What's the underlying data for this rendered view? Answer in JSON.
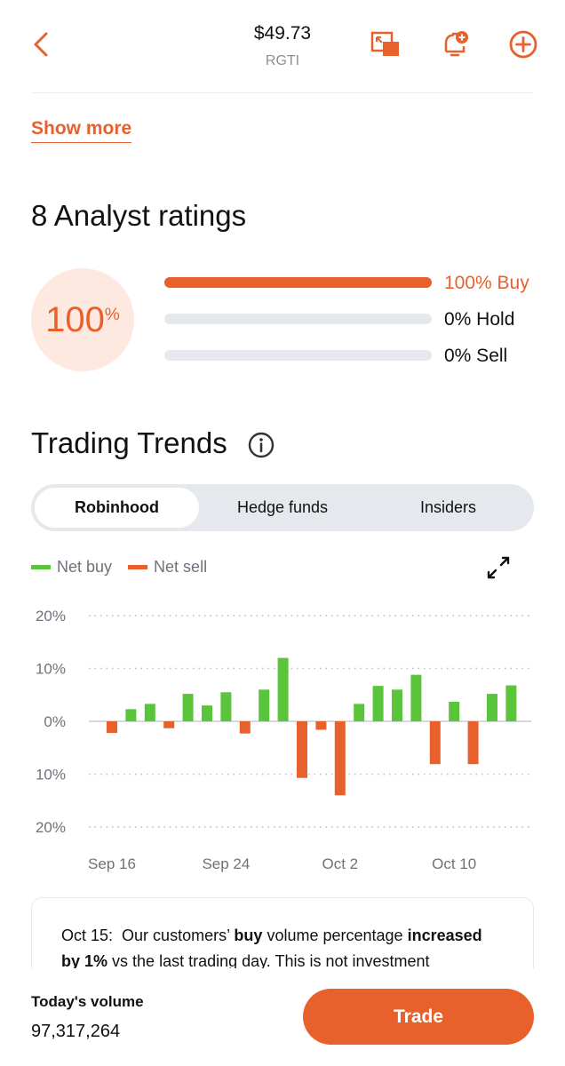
{
  "header": {
    "price": "$49.73",
    "ticker": "RGTI",
    "icons": [
      "back-arrow-icon",
      "picture-in-picture-icon",
      "bell-add-icon",
      "plus-circle-icon"
    ]
  },
  "about": {
    "show_more_label": "Show more"
  },
  "analyst": {
    "title": "8 Analyst ratings",
    "headline_value": "100",
    "headline_unit": "%",
    "ratings": [
      {
        "label": "100% Buy",
        "fraction": 1.0
      },
      {
        "label": "0% Hold",
        "fraction": 0.0
      },
      {
        "label": "0% Sell",
        "fraction": 0.0
      }
    ]
  },
  "trends": {
    "title": "Trading Trends",
    "tabs": [
      {
        "label": "Robinhood",
        "active": true
      },
      {
        "label": "Hedge funds",
        "active": false
      },
      {
        "label": "Insiders",
        "active": false
      }
    ],
    "legend": {
      "buy_label": "Net buy",
      "sell_label": "Net sell"
    },
    "summary": {
      "date": "Oct 15:",
      "text_1": "Our customers’",
      "bold_1": "buy",
      "text_2": "volume percentage",
      "bold_2": "increased by 1%",
      "text_3": "vs the last trading day. This is not investment"
    }
  },
  "colors": {
    "accent": "#e8602c",
    "buy": "#5ac53b",
    "sell": "#e8602c",
    "track": "#e5e9ee"
  },
  "chart_data": {
    "type": "bar",
    "x": [
      "Sep 16",
      "Sep 17",
      "Sep 18",
      "Sep 19",
      "Sep 20",
      "Sep 23",
      "Sep 24",
      "Sep 25",
      "Sep 26",
      "Sep 27",
      "Sep 30",
      "Oct 1",
      "Oct 2",
      "Oct 3",
      "Oct 4",
      "Oct 7",
      "Oct 8",
      "Oct 9",
      "Oct 10",
      "Oct 11",
      "Oct 14",
      "Oct 15"
    ],
    "values": [
      -2.2,
      2.3,
      3.3,
      -1.3,
      5.2,
      3.0,
      5.5,
      -2.3,
      6.0,
      12.0,
      -10.7,
      -1.6,
      -14.0,
      3.3,
      6.7,
      6.0,
      8.8,
      -8.1,
      3.7,
      -8.1,
      5.2,
      6.8
    ],
    "tick_labels_x": [
      "Sep 16",
      "Sep 24",
      "Oct 2",
      "Oct 10"
    ],
    "tick_labels_y": [
      "20%",
      "10%",
      "0%",
      "10%",
      "20%"
    ],
    "ylim": [
      -20,
      20
    ],
    "grid": true
  },
  "footer": {
    "volume_label": "Today's volume",
    "volume_value": "97,317,264",
    "trade_label": "Trade"
  }
}
